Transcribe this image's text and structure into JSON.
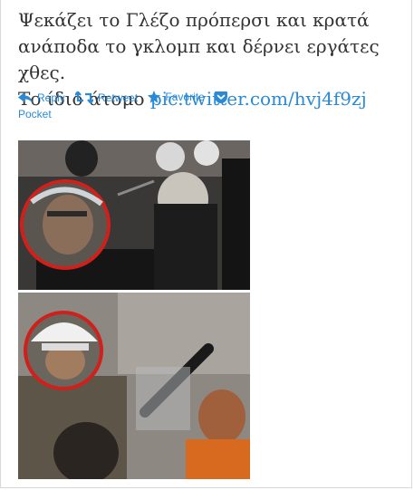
{
  "tweet": {
    "text_line1": "Ψεκάζει το Γλέζο πρόπερσι και κρατά",
    "text_line2": "ανάποδα το γκλομπ και δέρνει εργάτες χθες.",
    "text_line3_prefix": "Το ίδιο άτομο ",
    "link": "pic.twitter.com/hvj4f9zj"
  },
  "actions": {
    "reply": "Reply",
    "retweet": "Retweet",
    "favorite": "Favorite",
    "pocket": "Pocket"
  },
  "colors": {
    "link": "#2a8ad6",
    "text": "#333333",
    "highlight_circle": "#d0201c"
  },
  "icons": [
    "reply-icon",
    "retweet-icon",
    "star-icon",
    "pocket-icon"
  ]
}
